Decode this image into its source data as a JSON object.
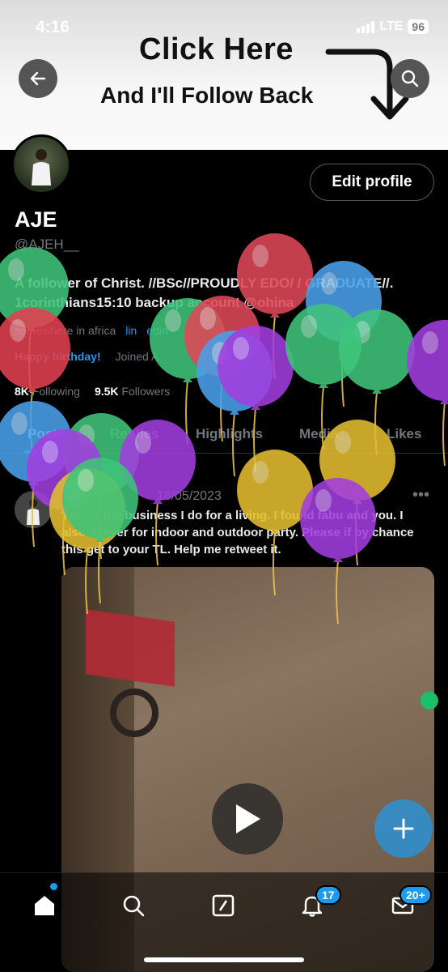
{
  "status_bar": {
    "time": "4:16",
    "network": "LTE",
    "battery": "96"
  },
  "banner": {
    "title": "Click Here",
    "subtitle": "And I'll Follow Back"
  },
  "profile": {
    "edit_button": "Edit profile",
    "name": "AJE",
    "handle": "@AJEH__",
    "bio": "A follower of Christ. //BSc//PROUDLY EDO/ / GRADUATE//. 1corinthians15:10 backup account @ohina",
    "location": "somewhere in africa",
    "link": "lin",
    "extra": "edin",
    "birthday": "Happy birthday!",
    "joined": "Joined A",
    "following_count": "8K",
    "following_label": "Following",
    "followers_count": "9.5K",
    "followers_label": "Followers"
  },
  "tabs": [
    "Posts",
    "Replies",
    "Highlights",
    "Media",
    "Likes"
  ],
  "tweet": {
    "author": "AJE",
    "date": "· 18/05/2023",
    "text": "This is the business I do for a living. I found fabu and you. I also deliver for indoor and outdoor party. Please if by chance this get to your TL. Help me retweet it."
  },
  "nav": {
    "notifications_badge": "17",
    "messages_badge": "20+"
  },
  "colors": {
    "accent": "#1d9bf0",
    "background": "#000000",
    "muted": "#71767b"
  },
  "icons": [
    "back-arrow-icon",
    "search-icon",
    "play-icon",
    "plus-icon",
    "home-icon",
    "explore-icon",
    "grok-icon",
    "bell-icon",
    "mail-icon"
  ]
}
